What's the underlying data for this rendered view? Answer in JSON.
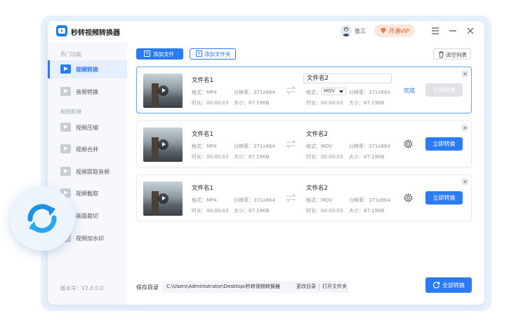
{
  "app": {
    "title": "秒转视频转换器"
  },
  "header": {
    "username": "张三",
    "vip_label": "开通VIP"
  },
  "sidebar": {
    "sections": [
      {
        "label": "热门功能"
      },
      {
        "label": "视频剪辑"
      }
    ],
    "items": [
      {
        "label": "视频转换",
        "active": true
      },
      {
        "label": "音频转换"
      },
      {
        "label": "视频压缩"
      },
      {
        "label": "视频合并"
      },
      {
        "label": "视频提取音频"
      },
      {
        "label": "视频截取"
      },
      {
        "label": "画面裁切"
      },
      {
        "label": "视频加水印"
      }
    ],
    "version": "版本号：V2.0.0.0"
  },
  "toolbar": {
    "add_file": "添加文件",
    "add_folder": "添加文件夹",
    "clear_list": "清空列表"
  },
  "files": [
    {
      "src_name": "文件名1",
      "src_format": "格式：MP4",
      "src_resolution": "分辨率：371x864",
      "src_duration": "时长：00:00:03",
      "src_size": "大小：87.19KB",
      "out_name": "文件名2",
      "out_format_label": "格式：",
      "out_format_value": "MOV",
      "out_resolution": "分辨率：371x864",
      "out_duration": "时长：00:00:03",
      "out_size": "大小：87.19KB",
      "status": "完成",
      "action": "立即转换"
    },
    {
      "src_name": "文件名1",
      "src_format": "格式：MP4",
      "src_resolution": "分辨率：371x864",
      "src_duration": "时长：00:00:03",
      "src_size": "大小：87.19KB",
      "out_name": "文件名2",
      "out_format": "格式：MOV",
      "out_resolution": "分辨率：371x864",
      "out_duration": "时长：00:00:03",
      "out_size": "大小：87.19KB",
      "action": "立即转换"
    },
    {
      "src_name": "文件名1",
      "src_format": "格式：MP4",
      "src_resolution": "分辨率：371x864",
      "src_duration": "时长：00:00:03",
      "src_size": "大小：87.19KB",
      "out_name": "文件名2",
      "out_format": "格式：MOV",
      "out_resolution": "分辨率：371x864",
      "out_duration": "时长：00:00:03",
      "out_size": "大小：87.19KB",
      "action": "立即转换"
    }
  ],
  "footer": {
    "save_dir_label": "保存目录",
    "save_dir_path": "C:\\Users\\Administrator\\Desktop\\秒转视频转换器",
    "change_dir": "更改目录",
    "open_folder": "打开文件夹",
    "convert_all": "全部转换"
  },
  "colors": {
    "accent": "#2a7bf4",
    "vip": "#e0562a"
  }
}
